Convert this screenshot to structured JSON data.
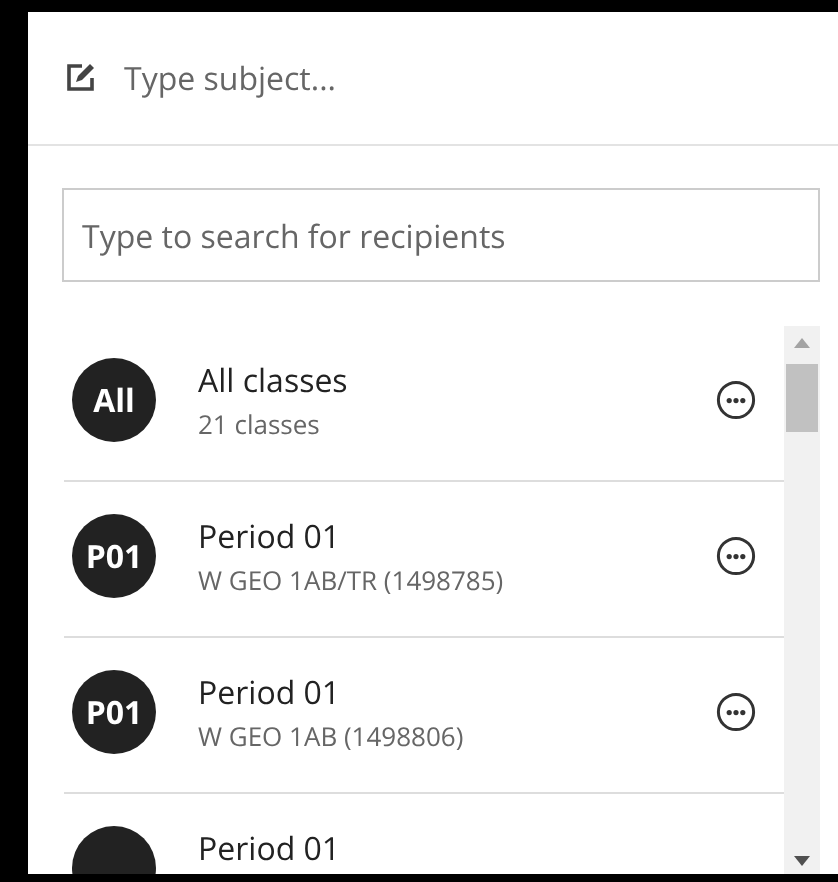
{
  "subject": {
    "placeholder": "Type subject..."
  },
  "search": {
    "placeholder": "Type to search for recipients"
  },
  "recipients": [
    {
      "avatar": "All",
      "title": "All classes",
      "subtitle": "21 classes"
    },
    {
      "avatar": "P01",
      "title": "Period 01",
      "subtitle": "W GEO 1AB/TR (1498785)"
    },
    {
      "avatar": "P01",
      "title": "Period 01",
      "subtitle": "W GEO 1AB (1498806)"
    },
    {
      "title": "Period 01"
    }
  ]
}
